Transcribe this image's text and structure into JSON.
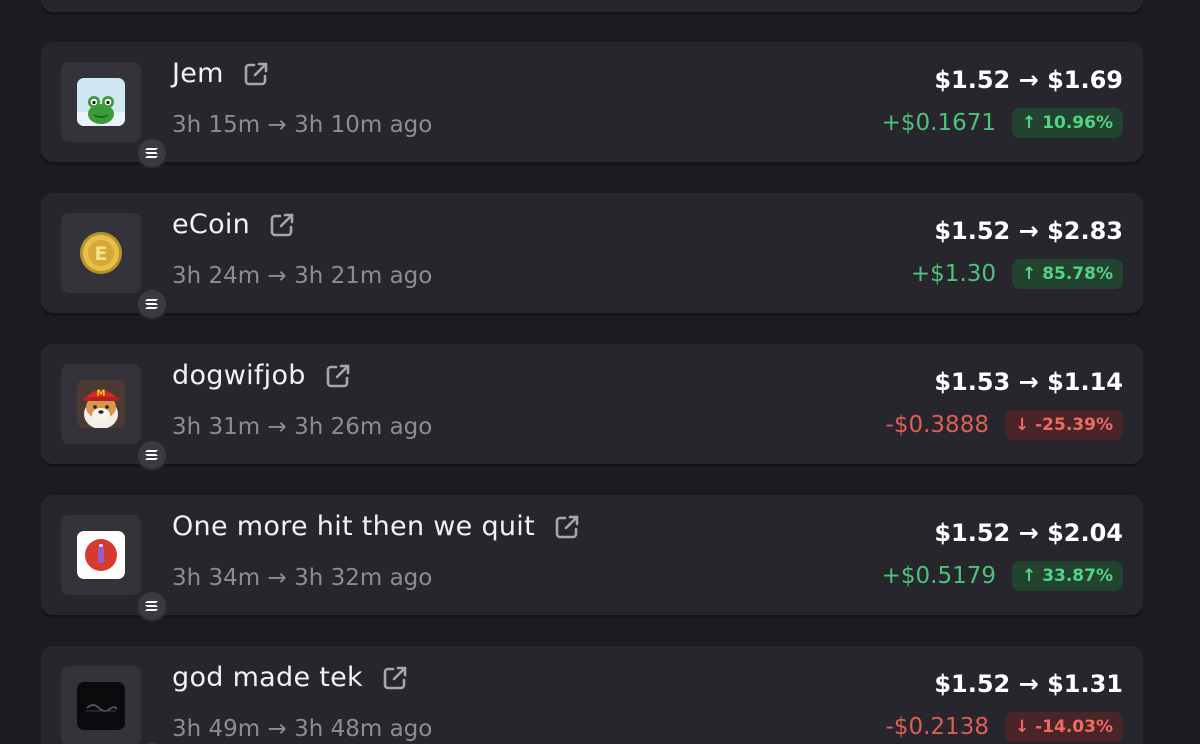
{
  "trades": [
    {
      "name": "Jem",
      "image": "frog-token-icon",
      "time_range": "3h 15m → 3h 10m ago",
      "price_change": "$1.52 → $1.69",
      "profit": "+$0.1671",
      "percent": "↑ 10.96%",
      "direction": "up"
    },
    {
      "name": "eCoin",
      "image": "gold-coin-token-icon",
      "time_range": "3h 24m → 3h 21m ago",
      "price_change": "$1.52 → $2.83",
      "profit": "+$1.30",
      "percent": "↑ 85.78%",
      "direction": "up"
    },
    {
      "name": "dogwifjob",
      "image": "dog-cap-token-icon",
      "time_range": "3h 31m → 3h 26m ago",
      "price_change": "$1.53 → $1.14",
      "profit": "-$0.3888",
      "percent": "↓ -25.39%",
      "direction": "down"
    },
    {
      "name": "One more hit then we quit",
      "image": "red-circle-token-icon",
      "time_range": "3h 34m → 3h 32m ago",
      "price_change": "$1.52 → $2.04",
      "profit": "+$0.5179",
      "percent": "↑ 33.87%",
      "direction": "up"
    },
    {
      "name": "god made tek",
      "image": "dark-brain-token-icon",
      "time_range": "3h 49m → 3h 48m ago",
      "price_change": "$1.52 → $1.31",
      "profit": "-$0.2138",
      "percent": "↓ -14.03%",
      "direction": "down"
    }
  ],
  "colors": {
    "background": "#1c1b21",
    "card": "#27262d",
    "gain": "#4cc27b",
    "loss": "#e05d55"
  }
}
